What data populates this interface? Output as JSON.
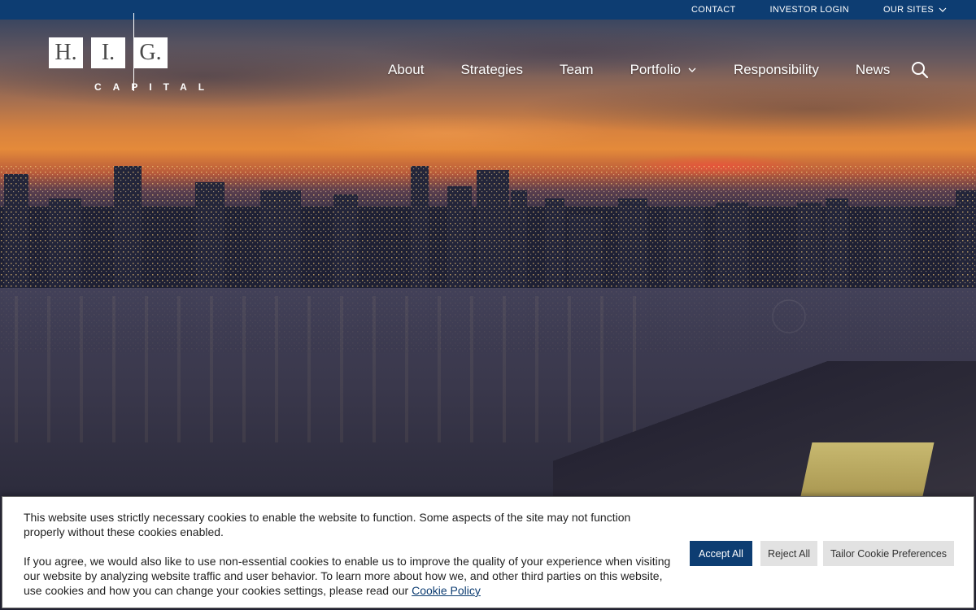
{
  "topbar": {
    "contact": "CONTACT",
    "investor_login": "INVESTOR LOGIN",
    "our_sites": "OUR SITES"
  },
  "logo": {
    "letters": [
      "H.",
      "I.",
      "G."
    ],
    "subtitle": "CAPITAL"
  },
  "nav": {
    "items": [
      {
        "label": "About"
      },
      {
        "label": "Strategies"
      },
      {
        "label": "Team"
      },
      {
        "label": "Portfolio"
      },
      {
        "label": "Responsibility"
      },
      {
        "label": "News"
      }
    ]
  },
  "cookie": {
    "paragraph1": "This website uses strictly necessary cookies to enable the website to function. Some aspects of the site may not function properly without these cookies enabled.",
    "paragraph2": "If you agree, we would also like to use non-essential cookies to enable us to improve the quality of your experience when visiting our website by analyzing website traffic and user behavior. To learn more about how we, and other third parties on this website, use cookies and how you can change your cookies settings, please read our",
    "policy_link": "Cookie Policy",
    "accept_label": "Accept All",
    "reject_label": "Reject All",
    "tailor_label": "Tailor Cookie Preferences"
  },
  "colors": {
    "brand_blue": "#0d3d72",
    "button_gray": "#e2e2e2"
  },
  "icons": {
    "search": "search-icon",
    "chevron": "chevron-down-icon"
  }
}
